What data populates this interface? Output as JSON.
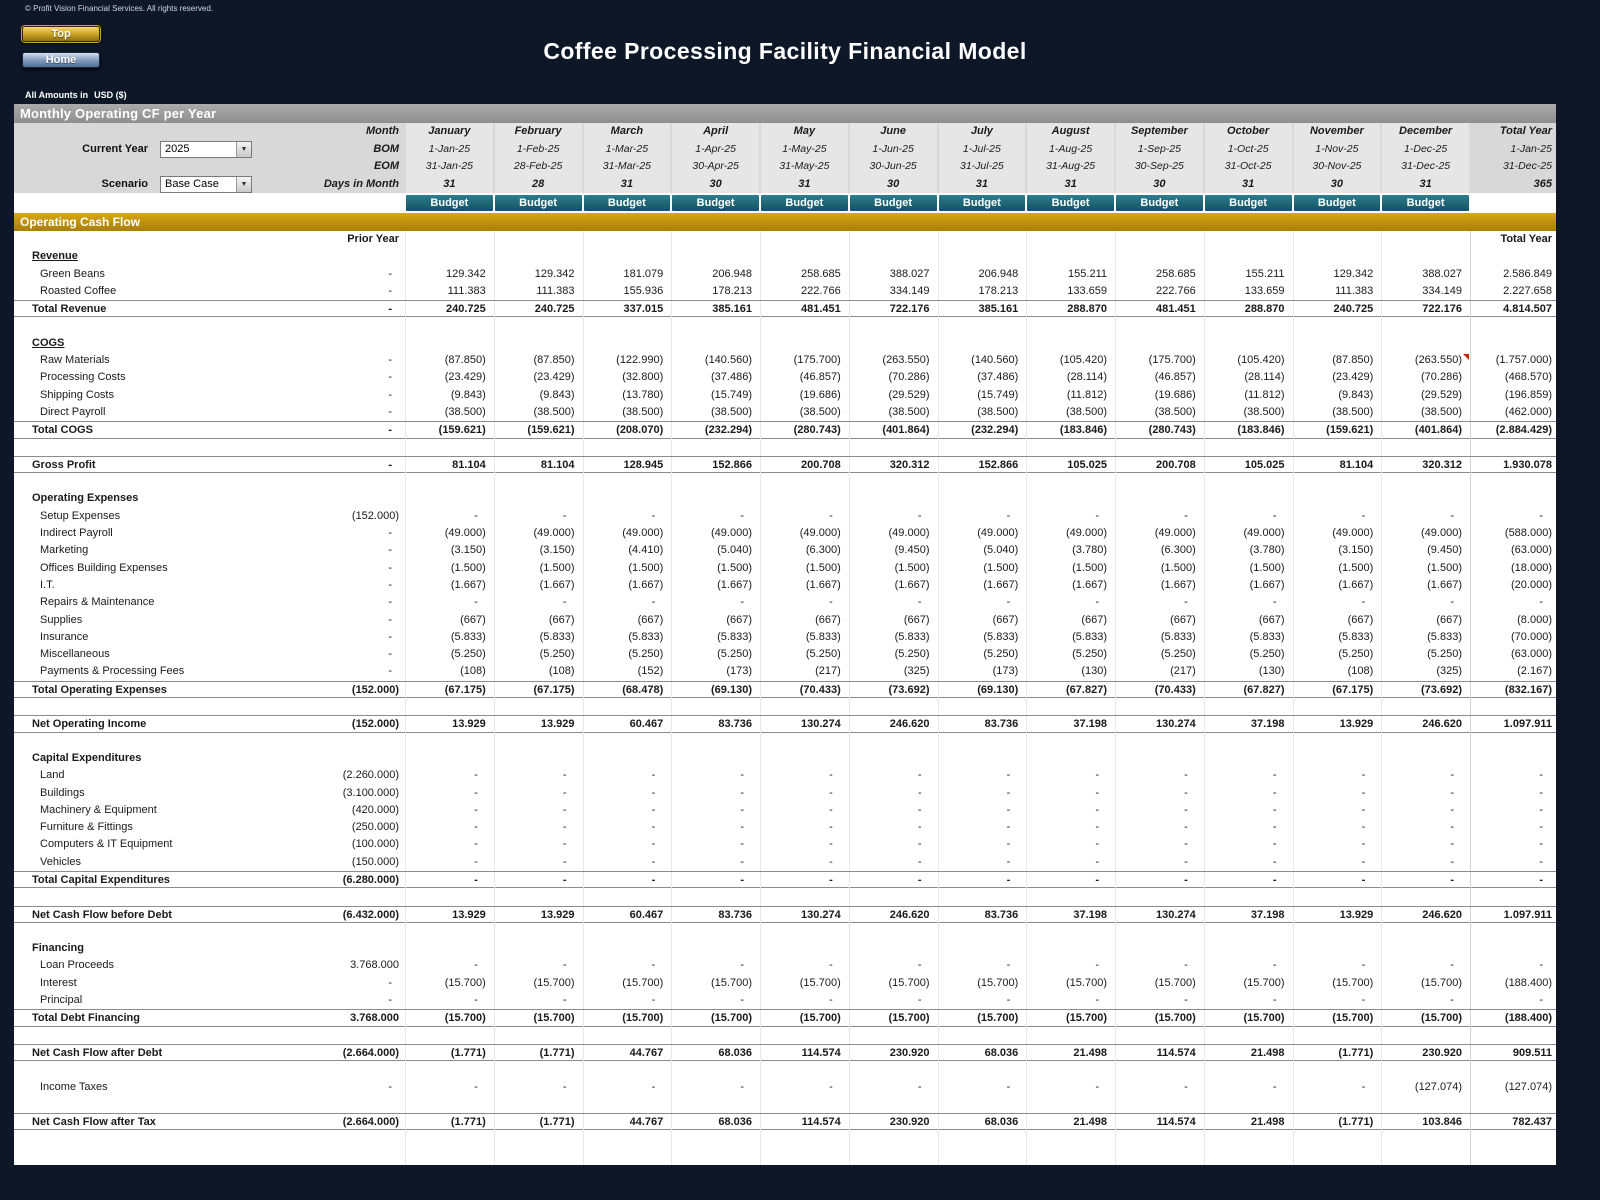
{
  "page": {
    "copyright": "© Profit Vision Financial Services. All rights reserved.",
    "title": "Coffee Processing Facility Financial Model",
    "buttons": {
      "top": "Top",
      "home": "Home"
    },
    "amounts_prefix": "All Amounts in",
    "amounts_currency": "USD ($)"
  },
  "section_bar": {
    "title": "Monthly Operating CF per Year"
  },
  "controls": {
    "current_year": {
      "label": "Current Year",
      "value": "2025"
    },
    "scenario": {
      "label": "Scenario",
      "value": "Base Case"
    }
  },
  "header": {
    "row_labels": {
      "month": "Month",
      "bom": "BOM",
      "eom": "EOM",
      "days": "Days in Month"
    },
    "months": [
      "January",
      "February",
      "March",
      "April",
      "May",
      "June",
      "July",
      "August",
      "September",
      "October",
      "November",
      "December"
    ],
    "bom": [
      "1-Jan-25",
      "1-Feb-25",
      "1-Mar-25",
      "1-Apr-25",
      "1-May-25",
      "1-Jun-25",
      "1-Jul-25",
      "1-Aug-25",
      "1-Sep-25",
      "1-Oct-25",
      "1-Nov-25",
      "1-Dec-25"
    ],
    "eom": [
      "31-Jan-25",
      "28-Feb-25",
      "31-Mar-25",
      "30-Apr-25",
      "31-May-25",
      "30-Jun-25",
      "31-Jul-25",
      "31-Aug-25",
      "30-Sep-25",
      "31-Oct-25",
      "30-Nov-25",
      "31-Dec-25"
    ],
    "days": [
      "31",
      "28",
      "31",
      "30",
      "31",
      "30",
      "31",
      "31",
      "30",
      "31",
      "30",
      "31"
    ],
    "total": {
      "label": "Total Year",
      "bom": "1-Jan-25",
      "eom": "31-Dec-25",
      "days": "365"
    },
    "budget_label": "Budget"
  },
  "band": {
    "title": "Operating Cash Flow"
  },
  "table": {
    "colhead": {
      "prior": "Prior Year",
      "total": "Total Year"
    },
    "rows": [
      {
        "type": "section",
        "underline": true,
        "label": "Revenue"
      },
      {
        "type": "item",
        "label": "Green Beans",
        "prior": "-",
        "values": [
          "129.342",
          "129.342",
          "181.079",
          "206.948",
          "258.685",
          "388.027",
          "206.948",
          "155.211",
          "258.685",
          "155.211",
          "129.342",
          "388.027"
        ],
        "total": "2.586.849"
      },
      {
        "type": "item",
        "label": "Roasted Coffee",
        "prior": "-",
        "values": [
          "111.383",
          "111.383",
          "155.936",
          "178.213",
          "222.766",
          "334.149",
          "178.213",
          "133.659",
          "222.766",
          "133.659",
          "111.383",
          "334.149"
        ],
        "total": "2.227.658"
      },
      {
        "type": "total",
        "label": "Total Revenue",
        "prior": "-",
        "values": [
          "240.725",
          "240.725",
          "337.015",
          "385.161",
          "481.451",
          "722.176",
          "385.161",
          "288.870",
          "481.451",
          "288.870",
          "240.725",
          "722.176"
        ],
        "total": "4.814.507"
      },
      {
        "type": "spacer"
      },
      {
        "type": "section",
        "underline": true,
        "label": "COGS"
      },
      {
        "type": "item",
        "label": "Raw Materials",
        "prior": "-",
        "values": [
          "(87.850)",
          "(87.850)",
          "(122.990)",
          "(140.560)",
          "(175.700)",
          "(263.550)",
          "(140.560)",
          "(105.420)",
          "(175.700)",
          "(105.420)",
          "(87.850)",
          "(263.550)"
        ],
        "total": "(1.757.000)",
        "marker_col": 11
      },
      {
        "type": "item",
        "label": "Processing Costs",
        "prior": "-",
        "values": [
          "(23.429)",
          "(23.429)",
          "(32.800)",
          "(37.486)",
          "(46.857)",
          "(70.286)",
          "(37.486)",
          "(28.114)",
          "(46.857)",
          "(28.114)",
          "(23.429)",
          "(70.286)"
        ],
        "total": "(468.570)"
      },
      {
        "type": "item",
        "label": "Shipping Costs",
        "prior": "-",
        "values": [
          "(9.843)",
          "(9.843)",
          "(13.780)",
          "(15.749)",
          "(19.686)",
          "(29.529)",
          "(15.749)",
          "(11.812)",
          "(19.686)",
          "(11.812)",
          "(9.843)",
          "(29.529)"
        ],
        "total": "(196.859)"
      },
      {
        "type": "item",
        "label": "Direct Payroll",
        "prior": "-",
        "values": [
          "(38.500)",
          "(38.500)",
          "(38.500)",
          "(38.500)",
          "(38.500)",
          "(38.500)",
          "(38.500)",
          "(38.500)",
          "(38.500)",
          "(38.500)",
          "(38.500)",
          "(38.500)"
        ],
        "total": "(462.000)"
      },
      {
        "type": "total",
        "label": "Total COGS",
        "prior": "-",
        "values": [
          "(159.621)",
          "(159.621)",
          "(208.070)",
          "(232.294)",
          "(280.743)",
          "(401.864)",
          "(232.294)",
          "(183.846)",
          "(280.743)",
          "(183.846)",
          "(159.621)",
          "(401.864)"
        ],
        "total": "(2.884.429)"
      },
      {
        "type": "spacer"
      },
      {
        "type": "total",
        "label": "Gross Profit",
        "prior": "-",
        "values": [
          "81.104",
          "81.104",
          "128.945",
          "152.866",
          "200.708",
          "320.312",
          "152.866",
          "105.025",
          "200.708",
          "105.025",
          "81.104",
          "320.312"
        ],
        "total": "1.930.078"
      },
      {
        "type": "spacer"
      },
      {
        "type": "section",
        "label": "Operating Expenses"
      },
      {
        "type": "item",
        "label": "Setup Expenses",
        "prior": "(152.000)",
        "values": [
          "-",
          "-",
          "-",
          "-",
          "-",
          "-",
          "-",
          "-",
          "-",
          "-",
          "-",
          "-"
        ],
        "total": "-"
      },
      {
        "type": "item",
        "label": "Indirect Payroll",
        "prior": "-",
        "values": [
          "(49.000)",
          "(49.000)",
          "(49.000)",
          "(49.000)",
          "(49.000)",
          "(49.000)",
          "(49.000)",
          "(49.000)",
          "(49.000)",
          "(49.000)",
          "(49.000)",
          "(49.000)"
        ],
        "total": "(588.000)"
      },
      {
        "type": "item",
        "label": "Marketing",
        "prior": "-",
        "values": [
          "(3.150)",
          "(3.150)",
          "(4.410)",
          "(5.040)",
          "(6.300)",
          "(9.450)",
          "(5.040)",
          "(3.780)",
          "(6.300)",
          "(3.780)",
          "(3.150)",
          "(9.450)"
        ],
        "total": "(63.000)"
      },
      {
        "type": "item",
        "label": "Offices Building Expenses",
        "prior": "-",
        "values": [
          "(1.500)",
          "(1.500)",
          "(1.500)",
          "(1.500)",
          "(1.500)",
          "(1.500)",
          "(1.500)",
          "(1.500)",
          "(1.500)",
          "(1.500)",
          "(1.500)",
          "(1.500)"
        ],
        "total": "(18.000)"
      },
      {
        "type": "item",
        "label": "I.T.",
        "prior": "-",
        "values": [
          "(1.667)",
          "(1.667)",
          "(1.667)",
          "(1.667)",
          "(1.667)",
          "(1.667)",
          "(1.667)",
          "(1.667)",
          "(1.667)",
          "(1.667)",
          "(1.667)",
          "(1.667)"
        ],
        "total": "(20.000)"
      },
      {
        "type": "item",
        "label": "Repairs & Maintenance",
        "prior": "-",
        "values": [
          "-",
          "-",
          "-",
          "-",
          "-",
          "-",
          "-",
          "-",
          "-",
          "-",
          "-",
          "-"
        ],
        "total": "-"
      },
      {
        "type": "item",
        "label": "Supplies",
        "prior": "-",
        "values": [
          "(667)",
          "(667)",
          "(667)",
          "(667)",
          "(667)",
          "(667)",
          "(667)",
          "(667)",
          "(667)",
          "(667)",
          "(667)",
          "(667)"
        ],
        "total": "(8.000)"
      },
      {
        "type": "item",
        "label": "Insurance",
        "prior": "-",
        "values": [
          "(5.833)",
          "(5.833)",
          "(5.833)",
          "(5.833)",
          "(5.833)",
          "(5.833)",
          "(5.833)",
          "(5.833)",
          "(5.833)",
          "(5.833)",
          "(5.833)",
          "(5.833)"
        ],
        "total": "(70.000)"
      },
      {
        "type": "item",
        "label": "Miscellaneous",
        "prior": "-",
        "values": [
          "(5.250)",
          "(5.250)",
          "(5.250)",
          "(5.250)",
          "(5.250)",
          "(5.250)",
          "(5.250)",
          "(5.250)",
          "(5.250)",
          "(5.250)",
          "(5.250)",
          "(5.250)"
        ],
        "total": "(63.000)"
      },
      {
        "type": "item",
        "label": "Payments & Processing Fees",
        "prior": "-",
        "values": [
          "(108)",
          "(108)",
          "(152)",
          "(173)",
          "(217)",
          "(325)",
          "(173)",
          "(130)",
          "(217)",
          "(130)",
          "(108)",
          "(325)"
        ],
        "total": "(2.167)"
      },
      {
        "type": "total",
        "label": "Total Operating Expenses",
        "prior": "(152.000)",
        "values": [
          "(67.175)",
          "(67.175)",
          "(68.478)",
          "(69.130)",
          "(70.433)",
          "(73.692)",
          "(69.130)",
          "(67.827)",
          "(70.433)",
          "(67.827)",
          "(67.175)",
          "(73.692)"
        ],
        "total": "(832.167)"
      },
      {
        "type": "spacer"
      },
      {
        "type": "total",
        "label": "Net Operating Income",
        "prior": "(152.000)",
        "values": [
          "13.929",
          "13.929",
          "60.467",
          "83.736",
          "130.274",
          "246.620",
          "83.736",
          "37.198",
          "130.274",
          "37.198",
          "13.929",
          "246.620"
        ],
        "total": "1.097.911"
      },
      {
        "type": "spacer"
      },
      {
        "type": "section",
        "label": "Capital Expenditures"
      },
      {
        "type": "item",
        "label": "Land",
        "prior": "(2.260.000)",
        "values": [
          "-",
          "-",
          "-",
          "-",
          "-",
          "-",
          "-",
          "-",
          "-",
          "-",
          "-",
          "-"
        ],
        "total": "-"
      },
      {
        "type": "item",
        "label": "Buildings",
        "prior": "(3.100.000)",
        "values": [
          "-",
          "-",
          "-",
          "-",
          "-",
          "-",
          "-",
          "-",
          "-",
          "-",
          "-",
          "-"
        ],
        "total": "-"
      },
      {
        "type": "item",
        "label": "Machinery & Equipment",
        "prior": "(420.000)",
        "values": [
          "-",
          "-",
          "-",
          "-",
          "-",
          "-",
          "-",
          "-",
          "-",
          "-",
          "-",
          "-"
        ],
        "total": "-"
      },
      {
        "type": "item",
        "label": "Furniture & Fittings",
        "prior": "(250.000)",
        "values": [
          "-",
          "-",
          "-",
          "-",
          "-",
          "-",
          "-",
          "-",
          "-",
          "-",
          "-",
          "-"
        ],
        "total": "-"
      },
      {
        "type": "item",
        "label": "Computers & IT Equipment",
        "prior": "(100.000)",
        "values": [
          "-",
          "-",
          "-",
          "-",
          "-",
          "-",
          "-",
          "-",
          "-",
          "-",
          "-",
          "-"
        ],
        "total": "-"
      },
      {
        "type": "item",
        "label": "Vehicles",
        "prior": "(150.000)",
        "values": [
          "-",
          "-",
          "-",
          "-",
          "-",
          "-",
          "-",
          "-",
          "-",
          "-",
          "-",
          "-"
        ],
        "total": "-"
      },
      {
        "type": "total",
        "label": "Total Capital Expenditures",
        "prior": "(6.280.000)",
        "values": [
          "-",
          "-",
          "-",
          "-",
          "-",
          "-",
          "-",
          "-",
          "-",
          "-",
          "-",
          "-"
        ],
        "total": "-"
      },
      {
        "type": "spacer"
      },
      {
        "type": "total",
        "label": "Net Cash Flow before Debt",
        "prior": "(6.432.000)",
        "values": [
          "13.929",
          "13.929",
          "60.467",
          "83.736",
          "130.274",
          "246.620",
          "83.736",
          "37.198",
          "130.274",
          "37.198",
          "13.929",
          "246.620"
        ],
        "total": "1.097.911"
      },
      {
        "type": "spacer"
      },
      {
        "type": "section",
        "label": "Financing"
      },
      {
        "type": "item",
        "label": "Loan Proceeds",
        "prior": "3.768.000",
        "values": [
          "-",
          "-",
          "-",
          "-",
          "-",
          "-",
          "-",
          "-",
          "-",
          "-",
          "-",
          "-"
        ],
        "total": "-"
      },
      {
        "type": "item",
        "label": "Interest",
        "prior": "-",
        "values": [
          "(15.700)",
          "(15.700)",
          "(15.700)",
          "(15.700)",
          "(15.700)",
          "(15.700)",
          "(15.700)",
          "(15.700)",
          "(15.700)",
          "(15.700)",
          "(15.700)",
          "(15.700)"
        ],
        "total": "(188.400)"
      },
      {
        "type": "item",
        "label": "Principal",
        "prior": "-",
        "values": [
          "-",
          "-",
          "-",
          "-",
          "-",
          "-",
          "-",
          "-",
          "-",
          "-",
          "-",
          "-"
        ],
        "total": "-"
      },
      {
        "type": "total",
        "label": "Total Debt Financing",
        "prior": "3.768.000",
        "values": [
          "(15.700)",
          "(15.700)",
          "(15.700)",
          "(15.700)",
          "(15.700)",
          "(15.700)",
          "(15.700)",
          "(15.700)",
          "(15.700)",
          "(15.700)",
          "(15.700)",
          "(15.700)"
        ],
        "total": "(188.400)"
      },
      {
        "type": "spacer"
      },
      {
        "type": "total",
        "label": "Net Cash Flow after Debt",
        "prior": "(2.664.000)",
        "values": [
          "(1.771)",
          "(1.771)",
          "44.767",
          "68.036",
          "114.574",
          "230.920",
          "68.036",
          "21.498",
          "114.574",
          "21.498",
          "(1.771)",
          "230.920"
        ],
        "total": "909.511"
      },
      {
        "type": "spacer"
      },
      {
        "type": "item",
        "label": "Income Taxes",
        "prior": "-",
        "values": [
          "-",
          "-",
          "-",
          "-",
          "-",
          "-",
          "-",
          "-",
          "-",
          "-",
          "-",
          "(127.074)"
        ],
        "total": "(127.074)"
      },
      {
        "type": "spacer"
      },
      {
        "type": "total",
        "label": "Net Cash Flow after Tax",
        "prior": "(2.664.000)",
        "values": [
          "(1.771)",
          "(1.771)",
          "44.767",
          "68.036",
          "114.574",
          "230.920",
          "68.036",
          "21.498",
          "114.574",
          "21.498",
          "(1.771)",
          "103.846"
        ],
        "total": "782.437"
      },
      {
        "type": "spacer"
      },
      {
        "type": "spacer"
      }
    ]
  },
  "colors": {
    "navy": "#0d1727",
    "bar_gray": "#8e8e8e",
    "header_gray": "#d8d8d8",
    "cell_gray": "#e6e6e6",
    "teal": "#14525f",
    "gold": "#a87e06",
    "marker_red": "#cc2200"
  }
}
